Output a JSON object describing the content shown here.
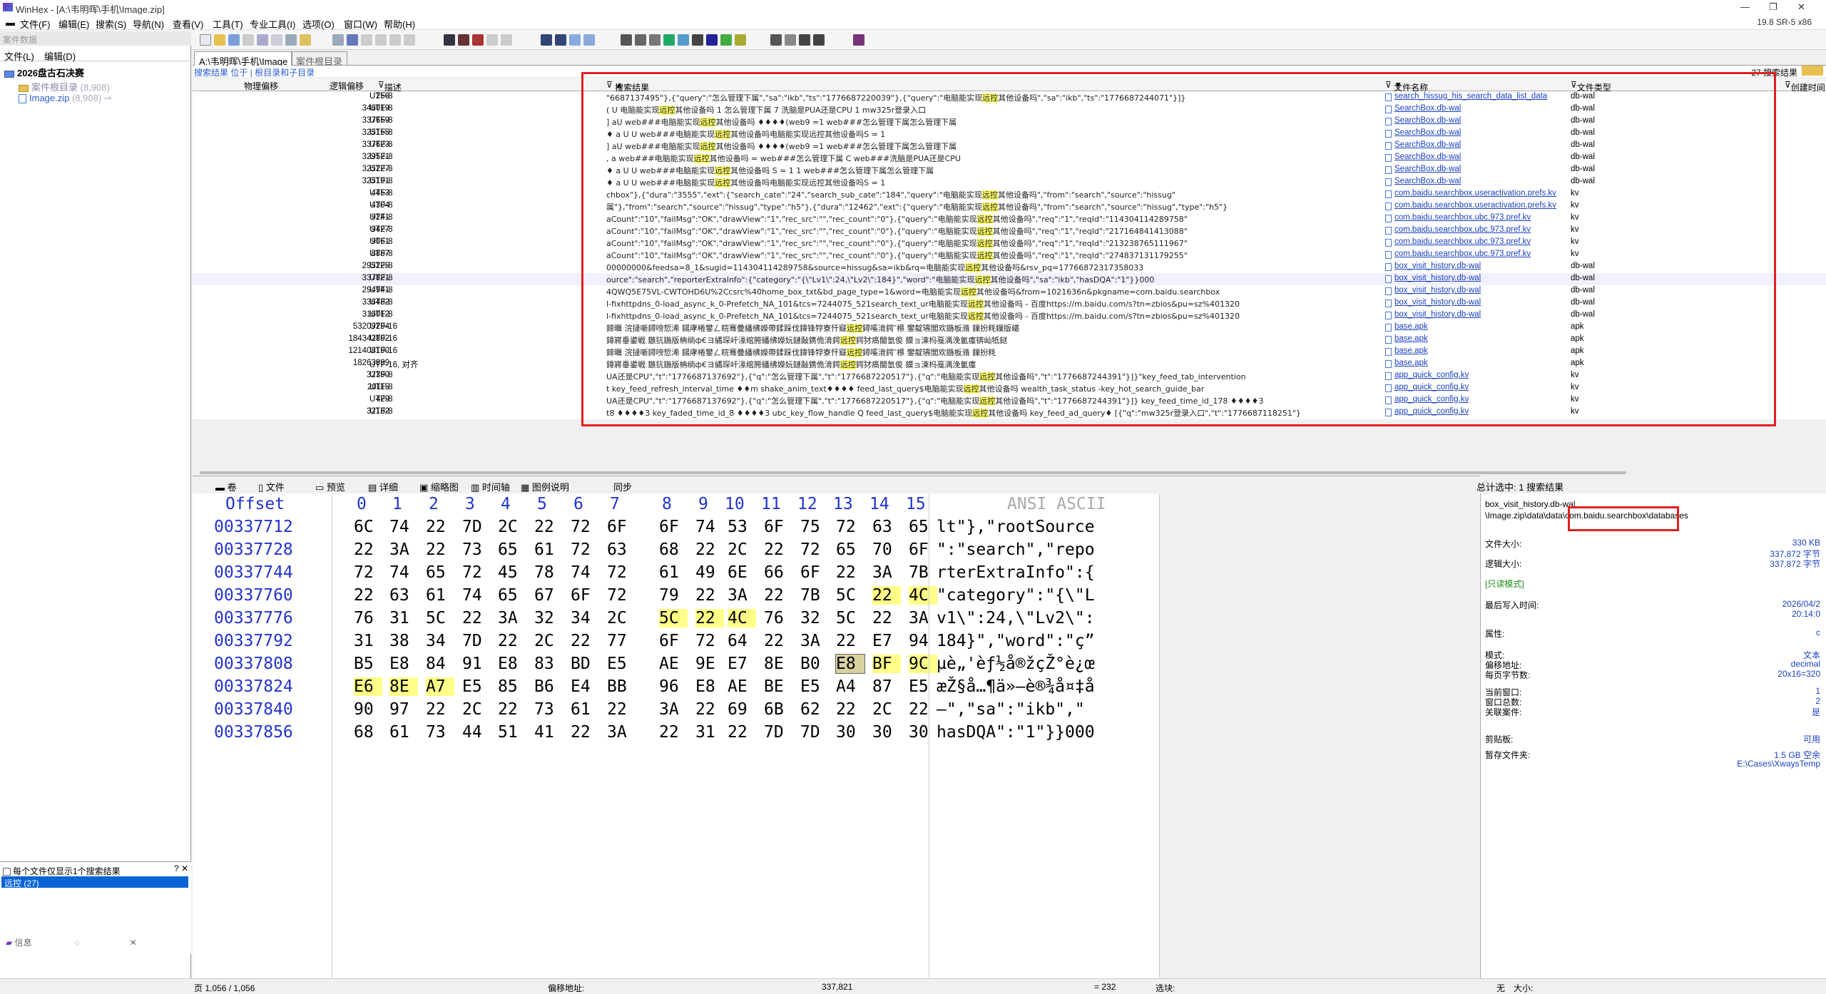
{
  "window": {
    "title": "WinHex - [A:\\韦明晖\\手机\\Image.zip]",
    "version": "19.8 SR-5 x86"
  },
  "menu": [
    "文件(F)",
    "编辑(E)",
    "搜索(S)",
    "导航(N)",
    "查看(V)",
    "工具(T)",
    "专业工具(I)",
    "选项(O)",
    "窗口(W)",
    "帮助(H)"
  ],
  "left_panel": {
    "header": "案件数据",
    "subtabs": [
      "文件(L)",
      "编辑(D)"
    ],
    "case_name": "2026盘古石决赛",
    "case_dir": "案件根目录",
    "case_dir_count": "(8,908)",
    "image": "Image.zip",
    "image_count": "(8,908)",
    "checkbox_label": "每个文件仅显示1个搜索结果",
    "search_term": "远控 (27)",
    "bottom_tab": "信息"
  },
  "main_tabs": [
    "A:\\韦明晖\\手机\\Image",
    "案件根目录"
  ],
  "breadcrumb": "搜索结果 位于 | 根目录和子目录",
  "result_count": "27 搜索结果",
  "columns": {
    "physical": "物理偏移",
    "logical": "逻辑偏移",
    "desc": "描述",
    "context": "搜索结果",
    "fname": "文件名称",
    "ftype": "文件类型",
    "created": "创建时间"
  },
  "results": [
    {
      "log": "256",
      "desc": "UTF-8",
      "pre": "\"6687137495\"},{\"query\":\"怎么管理下属\",\"sa\":\"ikb\",\"ts\":\"1776687220039\"},{\"query\":\"电脑能实现",
      "hit": "远控",
      "post": "其他设备吗\",\"sa\":\"ikb\",\"ts\":\"1776687244071\"}]}",
      "fname": "search_hissug_his_search_data_list_data",
      "ftype": "db-wal"
    },
    {
      "log": "346019",
      "desc": "UTF-8",
      "pre": "                                ( U 电脑能实现",
      "hit": "远控",
      "post": "其他设备吗   1 怎么管理下属   7 洗脑是PUA还是CPU    1 mw325r登录入口",
      "fname": "SearchBox.db-wal",
      "ftype": "db-wal"
    },
    {
      "log": "337659",
      "desc": "UTF-8",
      "pre": "          ]  aU  web###电脑能实现",
      "hit": "远控",
      "post": "其他设备吗 ♦♦♦♦(web9   =1  web###怎么管理下属怎么管理下属",
      "fname": "SearchBox.db-wal",
      "ftype": "db-wal"
    },
    {
      "log": "325155",
      "desc": "UTF-8",
      "pre": "               ♦  a U    U        web###电脑能实现",
      "hit": "远控",
      "post": "其他设备吗电脑能实现远控其他设备吗S  =  1",
      "fname": "SearchBox.db-wal",
      "ftype": "db-wal"
    },
    {
      "log": "337623",
      "desc": "UTF-8",
      "pre": "                       ]     aU   web###电脑能实现",
      "hit": "远控",
      "post": "其他设备吗 ♦♦♦♦(web9   =1   web###怎么管理下属怎么管理下属",
      "fname": "SearchBox.db-wal",
      "ftype": "db-wal"
    },
    {
      "log": "329521",
      "desc": "UTF-8",
      "pre": "                            , a web###电脑能实现",
      "hit": "远控",
      "post": "其他设备吗   = web###怎么管理下属   C web###洗脑是PUA还是CPU",
      "fname": "SearchBox.db-wal",
      "ftype": "db-wal"
    },
    {
      "log": "325227",
      "desc": "UTF-8",
      "pre": "   ♦  a U     U          web###电脑能实现",
      "hit": "远控",
      "post": "其他设备吗 S  =  1      1          web###怎么管理下属怎么管理下属",
      "fname": "SearchBox.db-wal",
      "ftype": "db-wal"
    },
    {
      "log": "325191",
      "desc": "UTF-8",
      "pre": "                  ♦  a U      U       web###电脑能实现",
      "hit": "远控",
      "post": "其他设备吗电脑能实现远控其他设备吗S  =   1",
      "fname": "SearchBox.db-wal",
      "ftype": "db-wal"
    },
    {
      "log": "4453",
      "desc": "UTF-8",
      "pre": "chbox\"},{\"dura\":\"3555\",\"ext\":{\"search_cate\":\"24\",\"search_sub_cate\":\"184\",\"query\":\"电脑能实现",
      "hit": "远控",
      "post": "其他设备吗\",\"from\":\"search\",\"source\":\"hissug\"",
      "fname": "com.baidu.searchbox.useractivation.prefs.kv",
      "ftype": "kv"
    },
    {
      "log": "4304",
      "desc": "UTF-8",
      "pre": "属\"},\"from\":\"search\",\"source\":\"hissug\",\"type\":\"h5\"},{\"dura\":\"12462\",\"ext\":{\"query\":\"电脑能实现",
      "hit": "远控",
      "post": "其他设备吗\",\"from\":\"search\",\"source\":\"hissug\",\"type\":\"h5\"}",
      "fname": "com.baidu.searchbox.useractivation.prefs.kv",
      "ftype": "kv"
    },
    {
      "log": "9241",
      "desc": "UTF-8",
      "pre": "aCount\":\"10\",\"failMsg\":\"OK\",\"drawView\":\"1\",\"rec_src\":\"\",\"rec_count\":\"0\"},{\"query\":\"电脑能实现",
      "hit": "远控",
      "post": "其他设备吗\",\"req\":\"1\",\"reqId\":\"114304114289758\"",
      "fname": "com.baidu.searchbox.ubc.973.pref.kv",
      "ftype": "kv"
    },
    {
      "log": "9427",
      "desc": "UTF-8",
      "pre": "aCount\":\"10\",\"failMsg\":\"OK\",\"drawView\":\"1\",\"rec_src\":\"\",\"rec_count\":\"0\"},{\"query\":\"电脑能实现",
      "hit": "远控",
      "post": "其他设备吗\",\"req\":\"1\",\"reqId\":\"217164841413088\"",
      "fname": "com.baidu.searchbox.ubc.973.pref.kv",
      "ftype": "kv"
    },
    {
      "log": "9061",
      "desc": "UTF-8",
      "pre": "aCount\":\"10\",\"failMsg\":\"OK\",\"drawView\":\"1\",\"rec_src\":\"\",\"rec_count\":\"0\"},{\"query\":\"电脑能实现",
      "hit": "远控",
      "post": "其他设备吗\",\"req\":\"1\",\"reqId\":\"213238765111967\"",
      "fname": "com.baidu.searchbox.ubc.973.pref.kv",
      "ftype": "kv"
    },
    {
      "log": "8887",
      "desc": "UTF-8",
      "pre": "aCount\":\"10\",\"failMsg\":\"OK\",\"drawView\":\"1\",\"rec_src\":\"\",\"rec_count\":\"0\"},{\"query\":\"电脑能实现",
      "hit": "远控",
      "post": "其他设备吗\",\"req\":\"1\",\"reqId\":\"274837131179255\"",
      "fname": "com.baidu.searchbox.ubc.973.pref.kv",
      "ftype": "kv"
    },
    {
      "log": "295225",
      "desc": "UTF-8",
      "pre": "00000000&feedsa=8_1&sugid=114304114289758&source=hissug&sa=ikb&rq=电脑能实现",
      "hit": "远控",
      "post": "其他设备吗&rsv_pq=17766872317358033",
      "fname": "box_visit_history.db-wal",
      "ftype": "db-wal"
    },
    {
      "log": "337821",
      "desc": "UTF-8",
      "pre": "ource\":\"search\",\"reporterExtraInfo\":{\"category\":\"{\\\"Lv1\\\":24,\\\"Lv2\\\":184}\",\"word\":\"电脑能实现",
      "hit": "远控",
      "post": "其他设备吗\",\"sa\":\"ikb\",\"hasDQA\":\"1\"}}000",
      "fname": "box_visit_history.db-wal",
      "ftype": "db-wal",
      "selected": true
    },
    {
      "log": "294941",
      "desc": "UTF-8",
      "pre": "4QWQ5E75VL-CWTOHD6U%2Ccsrc%40home_box_txt&bd_page_type=1&word=电脑能实现",
      "hit": "远控",
      "post": "其他设备吗&from=1021636n&pkgname=com.baidu.searchbox",
      "fname": "box_visit_history.db-wal",
      "ftype": "db-wal"
    },
    {
      "log": "336482",
      "desc": "UTF-8",
      "pre": "l-fixhttpdns_0-load_async_k_0-Prefetch_NA_101&tcs=7244075_521search_text_ur电脑能实现",
      "hit": "远控",
      "post": "其他设备吗 - 百度https://m.baidu.com/s?tn=zbios&pu=sz%401320",
      "fname": "box_visit_history.db-wal",
      "ftype": "db-wal"
    },
    {
      "log": "316012",
      "desc": "UTF-8",
      "pre": "l-fixhttpdns_0-load_async_k_0-Prefetch_NA_101&tcs=7244075_521search_text_ur电脑能实现",
      "hit": "远控",
      "post": "其他设备吗 - 百度https://m.baidu.com/s?tn=zbios&pu=sz%401320",
      "fname": "box_visit_history.db-wal",
      "ftype": "db-wal"
    },
    {
      "log": "53209294",
      "desc": "UTF-16",
      "pre": "鍗曞   浣撻噺鐞嗙悊浠   鍚庨棬鐢ㄥ睆骞曡繙绋嬫帶鍒跺伐鍏锋牸寮忓寲",
      "hit": "远控",
      "post": "鐞嗘湇鍔″櫒   鐢靛瓙閭欢鍦板潃   鏁扮粍鏁版嵁",
      "fname": "base.apk",
      "ftype": "apk"
    },
    {
      "log": "184342892",
      "desc": "UTF-16",
      "pre": "鍏嶈垂鍙戦   鏃犺鍦版柟绱ф€ヨ繘琛屽湪绾胯繙绋嬫妧鏈敮鎸佹湇鍔",
      "hit": "远控",
      "post": "鍔犲瘑閫氫俊   鏌ョ湅杩戞湡浼氳瘽锛屾牴鎹",
      "fname": "base.apk",
      "ftype": "apk"
    },
    {
      "log": "121408190",
      "desc": "UTF-16",
      "pre": "鍗曞   浣撻噺鐞嗙悊浠   鍚庨棬鐢ㄥ睆骞曡繙绋嬫帶鍒跺伐鍏锋牸寮忓寲",
      "hit": "远控",
      "post": "鐞嗘湇鍔″櫒   鐢靛瓙閭欢鍦板潃   鏁扮粍",
      "fname": "base.apk",
      "ftype": "apk"
    },
    {
      "log": "18263899",
      "desc": "UTF-16, 对齐",
      "pre": "鍏嶈垂鍙戦   鏃犺鍦版柟绱ф€ヨ繘琛屽湪绾胯繙绋嬫妧鏈敮鎸佹湇鍔",
      "hit": "远控",
      "post": "鍔犲瘑閫氫俊   鏌ョ湅杩戞湡浼氳瘽",
      "fname": "base.apk",
      "ftype": "apk"
    },
    {
      "log": "32390",
      "desc": "UTF-8",
      "pre": "UA还是CPU\",\"t\":\"1776687137692\"},{\"q\":\"怎么管理下属\",\"t\":\"1776687220517\"},{\"q\":\"电脑能实现",
      "hit": "远控",
      "post": "其他设备吗\",\"t\":\"1776687244391\"}]}\"key_feed_tab_intervention",
      "fname": "app_quick_config.kv",
      "ftype": "kv"
    },
    {
      "log": "20115",
      "desc": "UTF-8",
      "pre": "t   key_feed_refresh_interval_time ♦♦m  shake_anim_text♦♦♦♦   feed_last_query$电脑能实现",
      "hit": "远控",
      "post": "其他设备吗   wealth_task_status   -key_hot_search_guide_bar",
      "fname": "app_quick_config.kv",
      "ftype": "kv"
    },
    {
      "log": "429",
      "desc": "UTF-8",
      "pre": "UA还是CPU\",\"t\":\"1776687137692\"},{\"q\":\"怎么管理下属\",\"t\":\"1776687220517\"},{\"q\":\"电脑能实现",
      "hit": "远控",
      "post": "其他设备吗\",\"t\":\"1776687244391\"}]}   key_feed_time_id_178 ♦♦♦♦3",
      "fname": "app_quick_config.kv",
      "ftype": "kv"
    },
    {
      "log": "32182",
      "desc": "UTF-8",
      "pre": "t8 ♦♦♦♦3  key_faded_time_id_8 ♦♦♦♦3  ubc_key_flow_handle Q  feed_last_query$电脑能实现",
      "hit": "远控",
      "post": "其他设备吗   key_feed_ad_query♦ [{\"q\":\"mw325r登录入口\",\"t\":\"1776687118251\"}",
      "fname": "app_quick_config.kv",
      "ftype": "kv"
    }
  ],
  "mid_tabs": [
    "卷",
    "文件",
    "预览",
    "详细",
    "缩略图",
    "时间轴",
    "图例说明",
    "同步"
  ],
  "selected_total": "总计选中: 1 搜索结果",
  "hex": {
    "offset_label": "Offset",
    "col_labels": [
      "0",
      "1",
      "2",
      "3",
      "4",
      "5",
      "6",
      "7",
      "8",
      "9",
      "10",
      "11",
      "12",
      "13",
      "14",
      "15"
    ],
    "ascii_label": "ANSI ASCII",
    "lines": [
      {
        "off": "00337712",
        "bytes": [
          "6C",
          "74",
          "22",
          "7D",
          "2C",
          "22",
          "72",
          "6F",
          "6F",
          "74",
          "53",
          "6F",
          "75",
          "72",
          "63",
          "65"
        ],
        "ascii": "lt\"},\"rootSource"
      },
      {
        "off": "00337728",
        "bytes": [
          "22",
          "3A",
          "22",
          "73",
          "65",
          "61",
          "72",
          "63",
          "68",
          "22",
          "2C",
          "22",
          "72",
          "65",
          "70",
          "6F"
        ],
        "ascii": "\":\"search\",\"repo"
      },
      {
        "off": "00337744",
        "bytes": [
          "72",
          "74",
          "65",
          "72",
          "45",
          "78",
          "74",
          "72",
          "61",
          "49",
          "6E",
          "66",
          "6F",
          "22",
          "3A",
          "7B"
        ],
        "ascii": "rterExtraInfo\":{"
      },
      {
        "off": "00337760",
        "bytes": [
          "22",
          "63",
          "61",
          "74",
          "65",
          "67",
          "6F",
          "72",
          "79",
          "22",
          "3A",
          "22",
          "7B",
          "5C",
          "22",
          "4C"
        ],
        "ascii": "\"category\":\"{\\\"L"
      },
      {
        "off": "00337776",
        "bytes": [
          "76",
          "31",
          "5C",
          "22",
          "3A",
          "32",
          "34",
          "2C",
          "5C",
          "22",
          "4C",
          "76",
          "32",
          "5C",
          "22",
          "3A"
        ],
        "ascii": "v1\\\":24,\\\"Lv2\\\":"
      },
      {
        "off": "00337792",
        "bytes": [
          "31",
          "38",
          "34",
          "7D",
          "22",
          "2C",
          "22",
          "77",
          "6F",
          "72",
          "64",
          "22",
          "3A",
          "22",
          "E7",
          "94"
        ],
        "ascii": "184}\",\"word\":\"ç”"
      },
      {
        "off": "00337808",
        "bytes": [
          "B5",
          "E8",
          "84",
          "91",
          "E8",
          "83",
          "BD",
          "E5",
          "AE",
          "9E",
          "E7",
          "8E",
          "B0",
          "E8",
          "BF",
          "9C"
        ],
        "ascii": "µè„'èƒ½å®žçŽ°è¿œ"
      },
      {
        "off": "00337824",
        "bytes": [
          "E6",
          "8E",
          "A7",
          "E5",
          "85",
          "B6",
          "E4",
          "BB",
          "96",
          "E8",
          "AE",
          "BE",
          "E5",
          "A4",
          "87",
          "E5"
        ],
        "ascii": "æŽ§å…¶ä»–è®¾å¤‡å"
      },
      {
        "off": "00337840",
        "bytes": [
          "90",
          "97",
          "22",
          "2C",
          "22",
          "73",
          "61",
          "22",
          "3A",
          "22",
          "69",
          "6B",
          "62",
          "22",
          "2C",
          "22"
        ],
        "ascii": " —\",\"sa\":\"ikb\",\""
      },
      {
        "off": "00337856",
        "bytes": [
          "68",
          "61",
          "73",
          "44",
          "51",
          "41",
          "22",
          "3A",
          "22",
          "31",
          "22",
          "7D",
          "7D",
          "30",
          "30",
          "30"
        ],
        "ascii": "hasDQA\":\"1\"}}000"
      }
    ]
  },
  "info": {
    "file": "box_visit_history.db-wal",
    "path": "\\Image.zip\\data\\data\\com.baidu.searchbox\\databases",
    "rows": [
      {
        "k": "文件大小:",
        "v": "330 KB"
      },
      {
        "k": "",
        "v": "337,872 字节"
      },
      {
        "k": "逻辑大小:",
        "v": "337,872 字节"
      },
      {
        "k": "[只读模式]",
        "v": ""
      },
      {
        "k": "最后写入时间:",
        "v": "2026/04/2"
      },
      {
        "k": "",
        "v": "20:14:0"
      },
      {
        "k": "属性:",
        "v": "c"
      },
      {
        "k": "模式:",
        "v": "文本"
      },
      {
        "k": "偏移地址:",
        "v": "decimal"
      },
      {
        "k": "每页字节数:",
        "v": "20x16=320"
      },
      {
        "k": "当前窗口:",
        "v": "1"
      },
      {
        "k": "窗口总数:",
        "v": "2"
      },
      {
        "k": "关联案件:",
        "v": "是"
      },
      {
        "k": "剪贴板:",
        "v": "可用"
      },
      {
        "k": "暂存文件夹:",
        "v": "1.5 GB 空余"
      },
      {
        "k": "",
        "v": "E:\\Cases\\XwaysTemp"
      }
    ]
  },
  "status": {
    "page": "页 1,056 / 1,056",
    "offset_label": "偏移地址:",
    "offset": "337,821",
    "eq": "= 232",
    "sel": "选块:",
    "none": "无",
    "size": "大小:"
  }
}
